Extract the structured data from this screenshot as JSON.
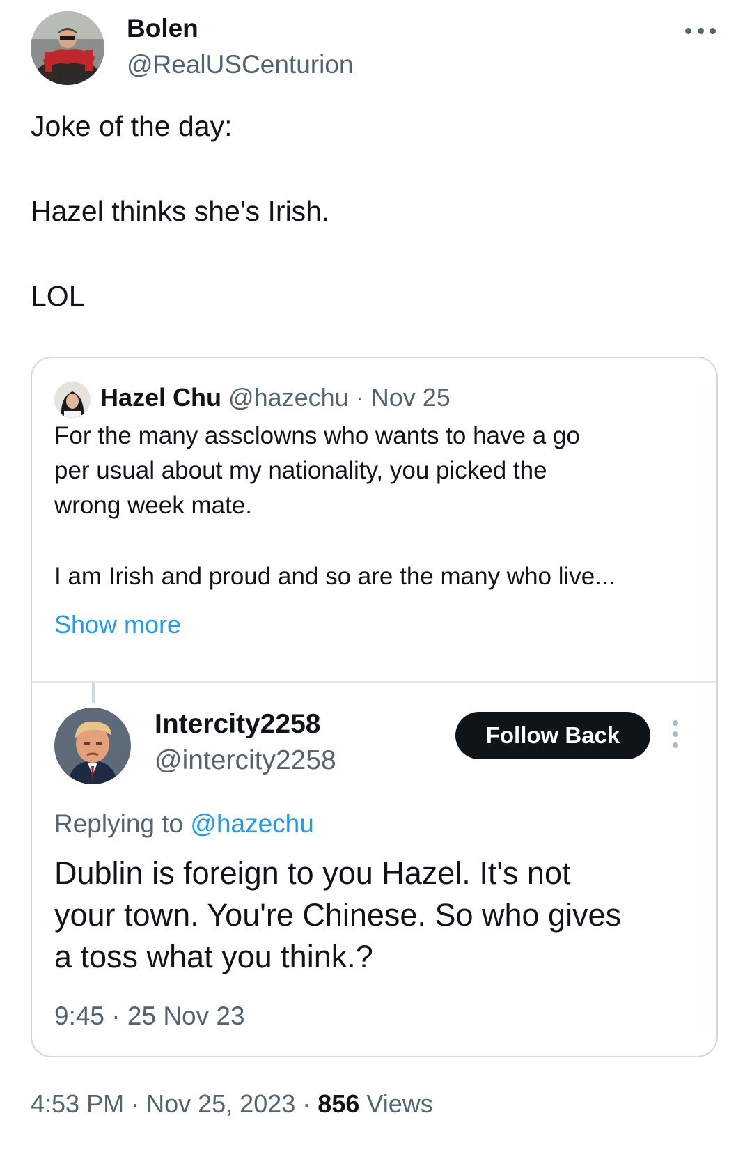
{
  "author": {
    "name": "Bolen",
    "handle": "@RealUSCenturion"
  },
  "tweet": {
    "lines": [
      "Joke of the day:",
      "Hazel thinks she's Irish.",
      "LOL"
    ]
  },
  "quoted": {
    "name": "Hazel Chu",
    "handle": "@hazechu",
    "separator": "·",
    "date": "Nov 25",
    "body_lines": [
      "For the many assclowns who wants to have a go",
      "per usual about my nationality, you picked the",
      "wrong week mate.",
      "I am Irish and proud and so are the many who live..."
    ],
    "show_more": "Show more"
  },
  "screenshot": {
    "name": "Intercity2258",
    "handle": "@intercity2258",
    "follow_label": "Follow Back",
    "replying_prefix": "Replying to",
    "replying_to": "@hazechu",
    "body_lines": [
      "Dublin is foreign to you Hazel. It's not",
      "your town. You're Chinese. So who gives",
      "a toss what you think.?"
    ],
    "timestamp": "9:45 · 25 Nov 23"
  },
  "footer": {
    "time": "4:53 PM",
    "separator": "·",
    "date": "Nov 25, 2023",
    "views_count": "856",
    "views_label": "Views"
  },
  "colors": {
    "text": "#0f1419",
    "secondary": "#536471",
    "link": "#1d9bf0",
    "border": "#cfd9de",
    "button_bg": "#0f1419"
  },
  "icons": {
    "more": "more-horizontal-icon",
    "kebab": "more-vertical-icon"
  }
}
